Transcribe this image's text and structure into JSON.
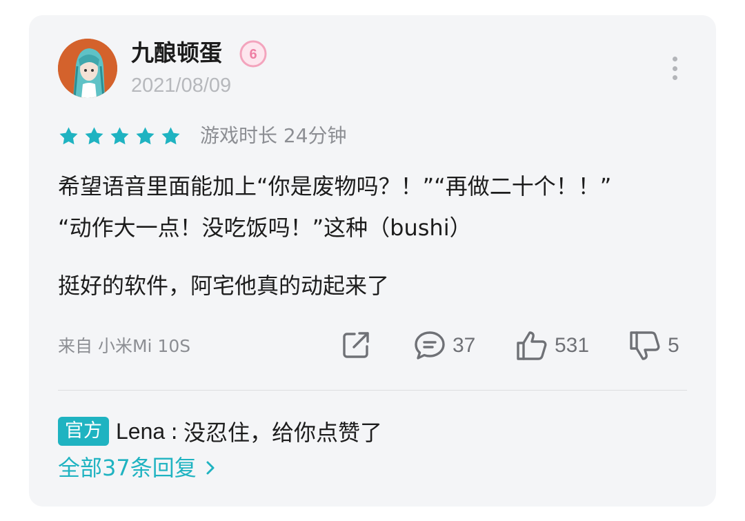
{
  "review": {
    "username": "九酿顿蛋",
    "level_badge": "6",
    "date": "2021/08/09",
    "rating": 5,
    "playtime": "游戏时长 24分钟",
    "content_paragraph_1_line_1": "希望语音里面能加上“你是废物吗？！”“再做二十个！！”",
    "content_paragraph_1_line_2": "“动作大一点！没吃饭吗！”这种（bushi）",
    "content_paragraph_2": "挺好的软件，阿宅他真的动起来了",
    "device": "来自 小米Mi 10S",
    "comment_count": "37",
    "like_count": "531",
    "dislike_count": "5"
  },
  "reply": {
    "tag": "官方",
    "author": "Lena",
    "separator": ":",
    "text": "没忍住，给你点赞了",
    "all_replies_label": "全部37条回复"
  },
  "icons": {
    "more": "more-vertical-icon",
    "share": "share-icon",
    "comment": "comment-icon",
    "like": "thumbs-up-icon",
    "dislike": "thumbs-down-icon",
    "star": "star-icon",
    "chevron": "chevron-right-icon"
  },
  "colors": {
    "accent": "#1fb3c1",
    "card_bg": "#f4f5f7",
    "badge_pink": "#f3a4bd"
  }
}
